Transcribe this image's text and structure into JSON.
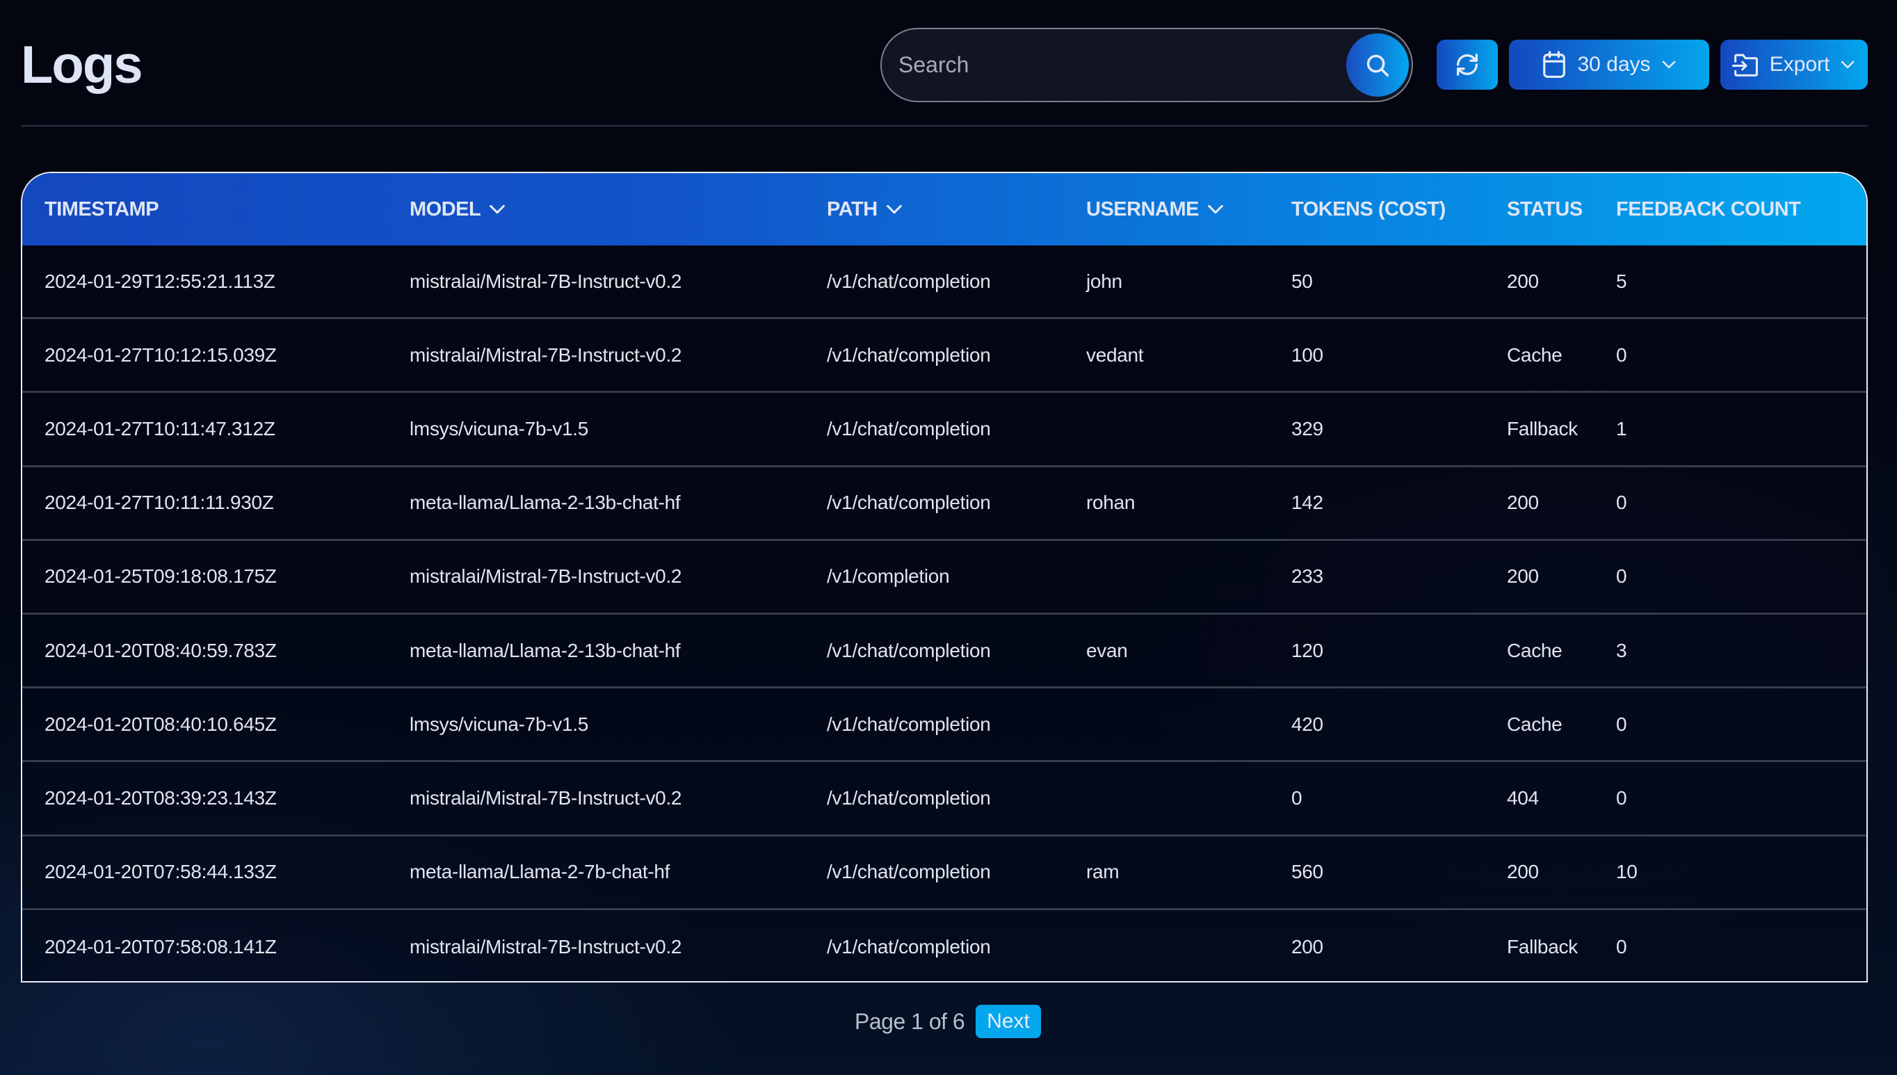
{
  "header": {
    "title": "Logs",
    "search": {
      "placeholder": "Search",
      "value": "",
      "button_icon": "search-icon"
    },
    "refresh_icon": "refresh-icon",
    "range": {
      "icon": "calendar-icon",
      "label": "30 days",
      "chevron": "chevron-down-icon"
    },
    "export": {
      "icon": "folder-export-icon",
      "label": "Export",
      "chevron": "chevron-down-icon"
    }
  },
  "table": {
    "columns": [
      {
        "label": "TIMESTAMP",
        "sortable": false
      },
      {
        "label": "MODEL",
        "sortable": true
      },
      {
        "label": "PATH",
        "sortable": true
      },
      {
        "label": "USERNAME",
        "sortable": true
      },
      {
        "label": "TOKENS (COST)",
        "sortable": false
      },
      {
        "label": "STATUS",
        "sortable": false
      },
      {
        "label": "FEEDBACK COUNT",
        "sortable": false
      }
    ],
    "rows": [
      [
        "2024-01-29T12:55:21.113Z",
        "mistralai/Mistral-7B-Instruct-v0.2",
        "/v1/chat/completion",
        "john",
        "50",
        "200",
        "5"
      ],
      [
        "2024-01-27T10:12:15.039Z",
        "mistralai/Mistral-7B-Instruct-v0.2",
        "/v1/chat/completion",
        "vedant",
        "100",
        "Cache",
        "0"
      ],
      [
        "2024-01-27T10:11:47.312Z",
        "lmsys/vicuna-7b-v1.5",
        "/v1/chat/completion",
        "",
        "329",
        "Fallback",
        "1"
      ],
      [
        "2024-01-27T10:11:11.930Z",
        "meta-llama/Llama-2-13b-chat-hf",
        "/v1/chat/completion",
        "rohan",
        "142",
        "200",
        "0"
      ],
      [
        "2024-01-25T09:18:08.175Z",
        "mistralai/Mistral-7B-Instruct-v0.2",
        "/v1/completion",
        "",
        "233",
        "200",
        "0"
      ],
      [
        "2024-01-20T08:40:59.783Z",
        "meta-llama/Llama-2-13b-chat-hf",
        "/v1/chat/completion",
        "evan",
        "120",
        "Cache",
        "3"
      ],
      [
        "2024-01-20T08:40:10.645Z",
        "lmsys/vicuna-7b-v1.5",
        "/v1/chat/completion",
        "",
        "420",
        "Cache",
        "0"
      ],
      [
        "2024-01-20T08:39:23.143Z",
        "mistralai/Mistral-7B-Instruct-v0.2",
        "/v1/chat/completion",
        "",
        "0",
        "404",
        "0"
      ],
      [
        "2024-01-20T07:58:44.133Z",
        "meta-llama/Llama-2-7b-chat-hf",
        "/v1/chat/completion",
        "ram",
        "560",
        "200",
        "10"
      ],
      [
        "2024-01-20T07:58:08.141Z",
        "mistralai/Mistral-7B-Instruct-v0.2",
        "/v1/chat/completion",
        "",
        "200",
        "Fallback",
        "0"
      ]
    ]
  },
  "pagination": {
    "text": "Page 1 of 6",
    "current_page": 1,
    "total_pages": 6,
    "next_label": "Next"
  },
  "colors": {
    "background": "#03050f",
    "accent_start": "#1448bf",
    "accent_end": "#02a7ee",
    "next_button": "#04a6ee"
  }
}
